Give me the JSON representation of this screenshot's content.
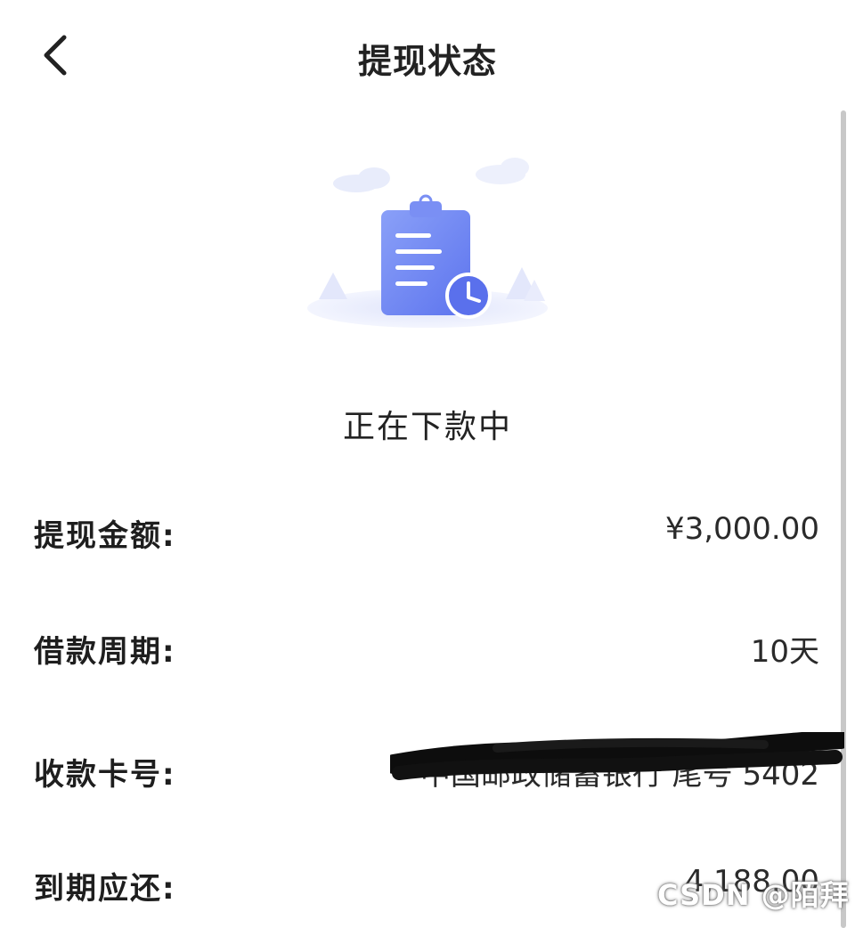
{
  "header": {
    "title": "提现状态"
  },
  "status": {
    "text": "正在下款中"
  },
  "details": {
    "amount": {
      "label": "提现金额:",
      "value": "¥3,000.00"
    },
    "period": {
      "label": "借款周期:",
      "value": "10天"
    },
    "card": {
      "label": "收款卡号:",
      "value": "中国邮政储蓄银行 尾号 5402"
    },
    "due": {
      "label": "到期应还:",
      "value": "4,188.00"
    }
  },
  "watermark": {
    "text": "CSDN @陌拜"
  },
  "icons": {
    "back": "chevron-left-icon",
    "illustration": "clipboard-clock-icon"
  },
  "colors": {
    "illustration_blue": "#6f86f2",
    "illustration_light": "#e7ebff"
  }
}
